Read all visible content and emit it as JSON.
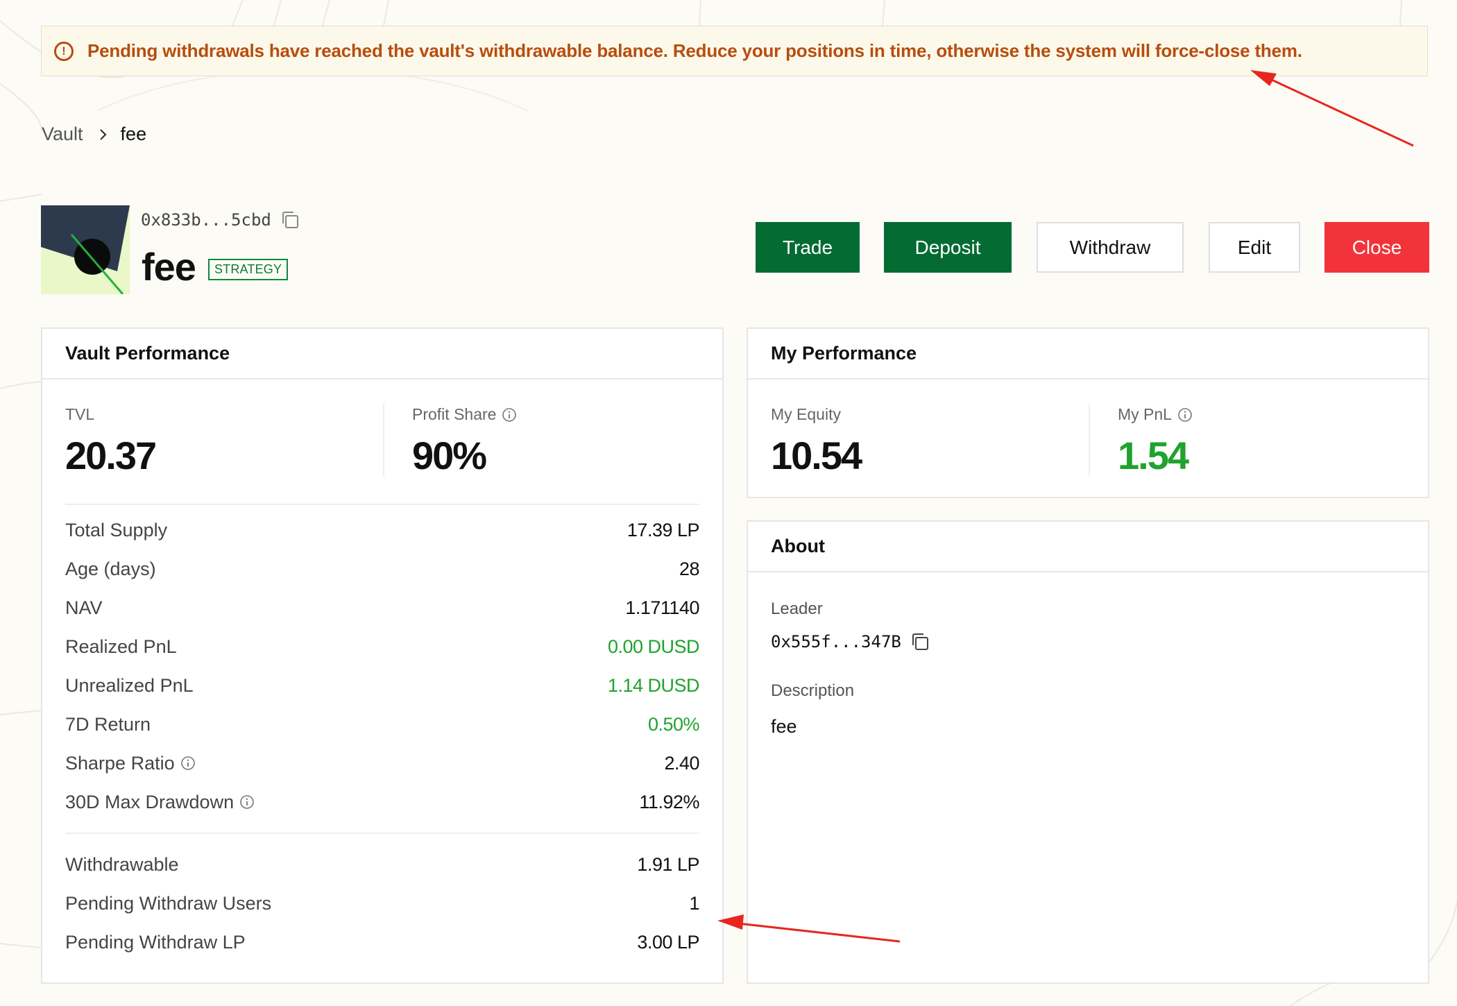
{
  "banner": {
    "icon": "alert-circle-icon",
    "text": "Pending withdrawals have reached the vault's withdrawable balance. Reduce your positions in time, otherwise the system will force-close them."
  },
  "breadcrumb": {
    "root": "Vault",
    "current": "fee"
  },
  "vault": {
    "address": "0x833b...5cbd",
    "name": "fee",
    "badge": "STRATEGY"
  },
  "actions": {
    "trade": "Trade",
    "deposit": "Deposit",
    "withdraw": "Withdraw",
    "edit": "Edit",
    "close": "Close"
  },
  "vault_performance": {
    "title": "Vault Performance",
    "tvl_label": "TVL",
    "tvl_value": "20.37",
    "profit_share_label": "Profit Share",
    "profit_share_value": "90%",
    "rows": [
      {
        "label": "Total Supply",
        "value": "17.39 LP"
      },
      {
        "label": "Age (days)",
        "value": "28"
      },
      {
        "label": "NAV",
        "value": "1.171140"
      },
      {
        "label": "Realized PnL",
        "value": "0.00 DUSD"
      },
      {
        "label": "Unrealized PnL",
        "value": "1.14 DUSD"
      },
      {
        "label": "7D Return",
        "value": "0.50%"
      },
      {
        "label": "Sharpe Ratio",
        "value": "2.40"
      },
      {
        "label": "30D Max Drawdown",
        "value": "11.92%"
      }
    ],
    "withdraw_rows": [
      {
        "label": "Withdrawable",
        "value": "1.91 LP"
      },
      {
        "label": "Pending Withdraw Users",
        "value": "1"
      },
      {
        "label": "Pending Withdraw LP",
        "value": "3.00 LP"
      }
    ]
  },
  "my_performance": {
    "title": "My Performance",
    "equity_label": "My Equity",
    "equity_value": "10.54",
    "pnl_label": "My PnL",
    "pnl_value": "1.54"
  },
  "about": {
    "title": "About",
    "leader_label": "Leader",
    "leader_address": "0x555f...347B",
    "description_label": "Description",
    "description": "fee"
  },
  "colors": {
    "brand_green": "#046b32",
    "close_red": "#f2333a",
    "positive_green": "#1fa22e",
    "warning_text": "#b74d0e",
    "annotation_arrow": "#e8261f"
  }
}
